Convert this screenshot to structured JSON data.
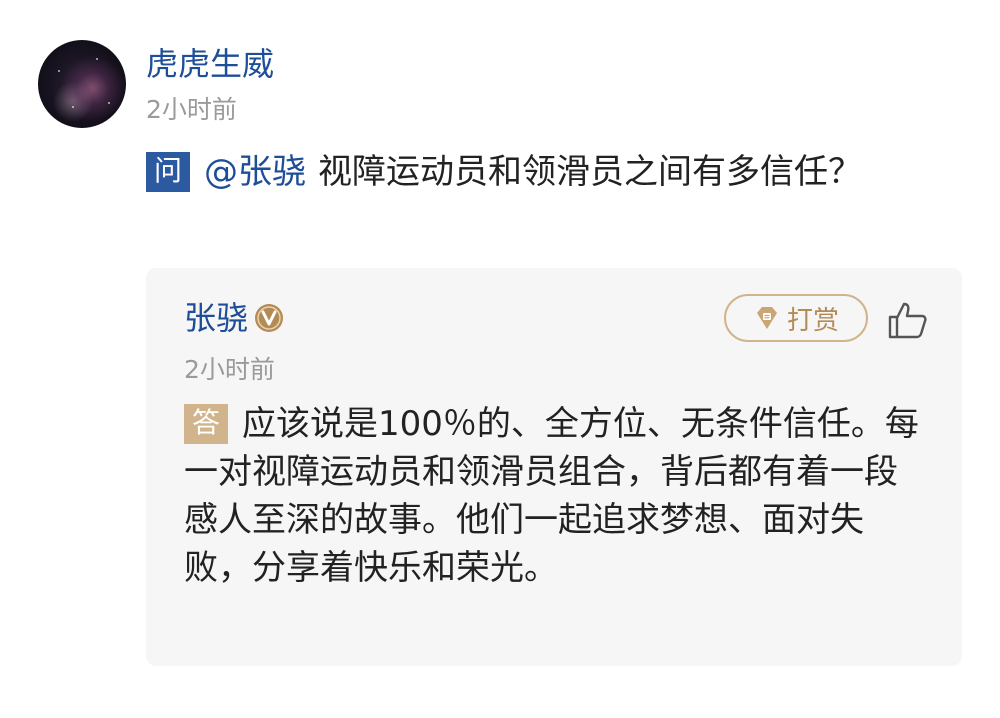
{
  "post": {
    "author": "虎虎生威",
    "time": "2小时前",
    "question_badge": "问",
    "mention": "@张骁",
    "question_text": "视障运动员和领滑员之间有多信任？"
  },
  "answer": {
    "author": "张骁",
    "verified_icon": "verified-v-badge",
    "time": "2小时前",
    "tip_label": "打赏",
    "tip_icon": "gem-icon",
    "like_icon": "thumbs-up-icon",
    "answer_badge": "答",
    "text": "应该说是100％的、全方位、无条件信任。每一对视障运动员和领滑员组合，背后都有着一段感人至深的故事。他们一起追求梦想、面对失败，分享着快乐和荣光。"
  },
  "colors": {
    "link_blue": "#1f4e99",
    "question_badge_bg": "#2c5aa0",
    "gold": "#d2b48c",
    "gray_text": "#9a9a9a",
    "card_bg": "#f6f6f6"
  }
}
